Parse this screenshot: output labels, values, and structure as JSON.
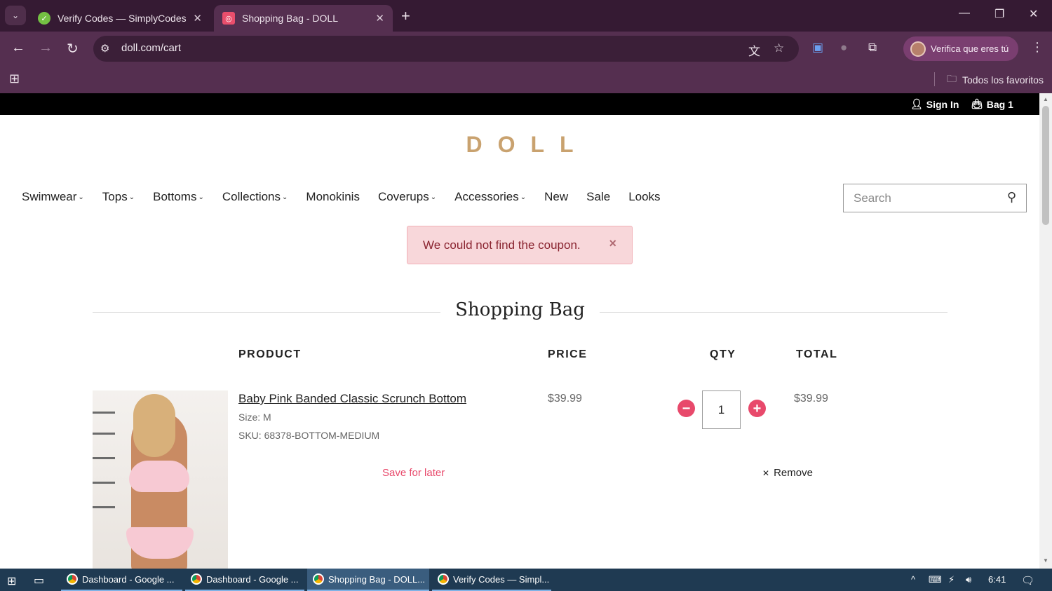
{
  "browser": {
    "tabs": [
      {
        "title": "Verify Codes — SimplyCodes",
        "active": false
      },
      {
        "title": "Shopping Bag - DOLL",
        "active": true
      }
    ],
    "url": "doll.com/cart",
    "profile_label": "Verifica que eres tú",
    "bookmarks_all": "Todos los favoritos"
  },
  "site": {
    "topbar": {
      "sign_in": "Sign In",
      "bag": "Bag 1"
    },
    "logo": "DOLL",
    "nav": [
      {
        "label": "Swimwear",
        "dropdown": true
      },
      {
        "label": "Tops",
        "dropdown": true
      },
      {
        "label": "Bottoms",
        "dropdown": true
      },
      {
        "label": "Collections",
        "dropdown": true
      },
      {
        "label": "Monokinis",
        "dropdown": false
      },
      {
        "label": "Coverups",
        "dropdown": true
      },
      {
        "label": "Accessories",
        "dropdown": true
      },
      {
        "label": "New",
        "dropdown": false
      },
      {
        "label": "Sale",
        "dropdown": false
      },
      {
        "label": "Looks",
        "dropdown": false
      }
    ],
    "search_placeholder": "Search",
    "alert": "We could not find the coupon.",
    "bag_title": "Shopping Bag",
    "columns": {
      "product": "PRODUCT",
      "price": "PRICE",
      "qty": "QTY",
      "total": "TOTAL"
    },
    "item": {
      "name": "Baby Pink Banded Classic Scrunch Bottom",
      "size": "Size: M",
      "sku": "SKU: 68378-BOTTOM-MEDIUM",
      "price": "$39.99",
      "qty": "1",
      "total": "$39.99",
      "save_for_later": "Save for later",
      "remove": "Remove"
    }
  },
  "taskbar": {
    "items": [
      {
        "label": "Dashboard - Google ...",
        "active": false
      },
      {
        "label": "Dashboard - Google ...",
        "active": false
      },
      {
        "label": "Shopping Bag - DOLL...",
        "active": true
      },
      {
        "label": "Verify Codes — Simpl...",
        "active": false
      }
    ],
    "time": "6:41"
  },
  "colors": {
    "accent_pink": "#e8496b",
    "logo_gold": "#c9a26f",
    "chrome_bg": "#552f50"
  }
}
